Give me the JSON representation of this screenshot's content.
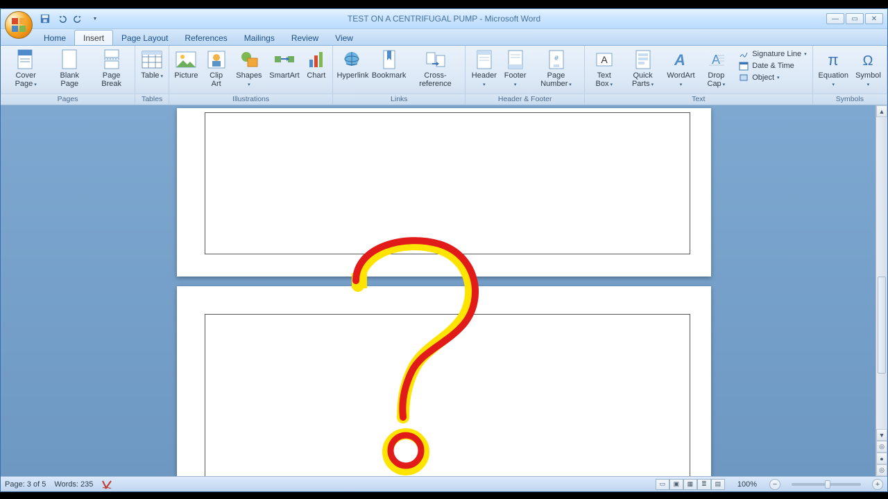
{
  "titlebar": {
    "document_title": "TEST ON A CENTRIFUGAL PUMP - Microsoft Word"
  },
  "tabs": {
    "home": "Home",
    "insert": "Insert",
    "page_layout": "Page Layout",
    "references": "References",
    "mailings": "Mailings",
    "review": "Review",
    "view": "View",
    "active": "insert"
  },
  "ribbon": {
    "pages": {
      "label": "Pages",
      "cover_page": "Cover Page",
      "blank_page": "Blank Page",
      "page_break": "Page Break"
    },
    "tables": {
      "label": "Tables",
      "table": "Table"
    },
    "illustrations": {
      "label": "Illustrations",
      "picture": "Picture",
      "clip_art": "Clip Art",
      "shapes": "Shapes",
      "smartart": "SmartArt",
      "chart": "Chart"
    },
    "links": {
      "label": "Links",
      "hyperlink": "Hyperlink",
      "bookmark": "Bookmark",
      "cross_reference": "Cross-reference"
    },
    "header_footer": {
      "label": "Header & Footer",
      "header": "Header",
      "footer": "Footer",
      "page_number": "Page Number"
    },
    "text": {
      "label": "Text",
      "text_box": "Text Box",
      "quick_parts": "Quick Parts",
      "wordart": "WordArt",
      "drop_cap": "Drop Cap",
      "signature_line": "Signature Line",
      "date_time": "Date & Time",
      "object": "Object"
    },
    "symbols": {
      "label": "Symbols",
      "equation": "Equation",
      "symbol": "Symbol"
    }
  },
  "status": {
    "page": "Page: 3 of 5",
    "words": "Words: 235",
    "zoom": "100%"
  }
}
